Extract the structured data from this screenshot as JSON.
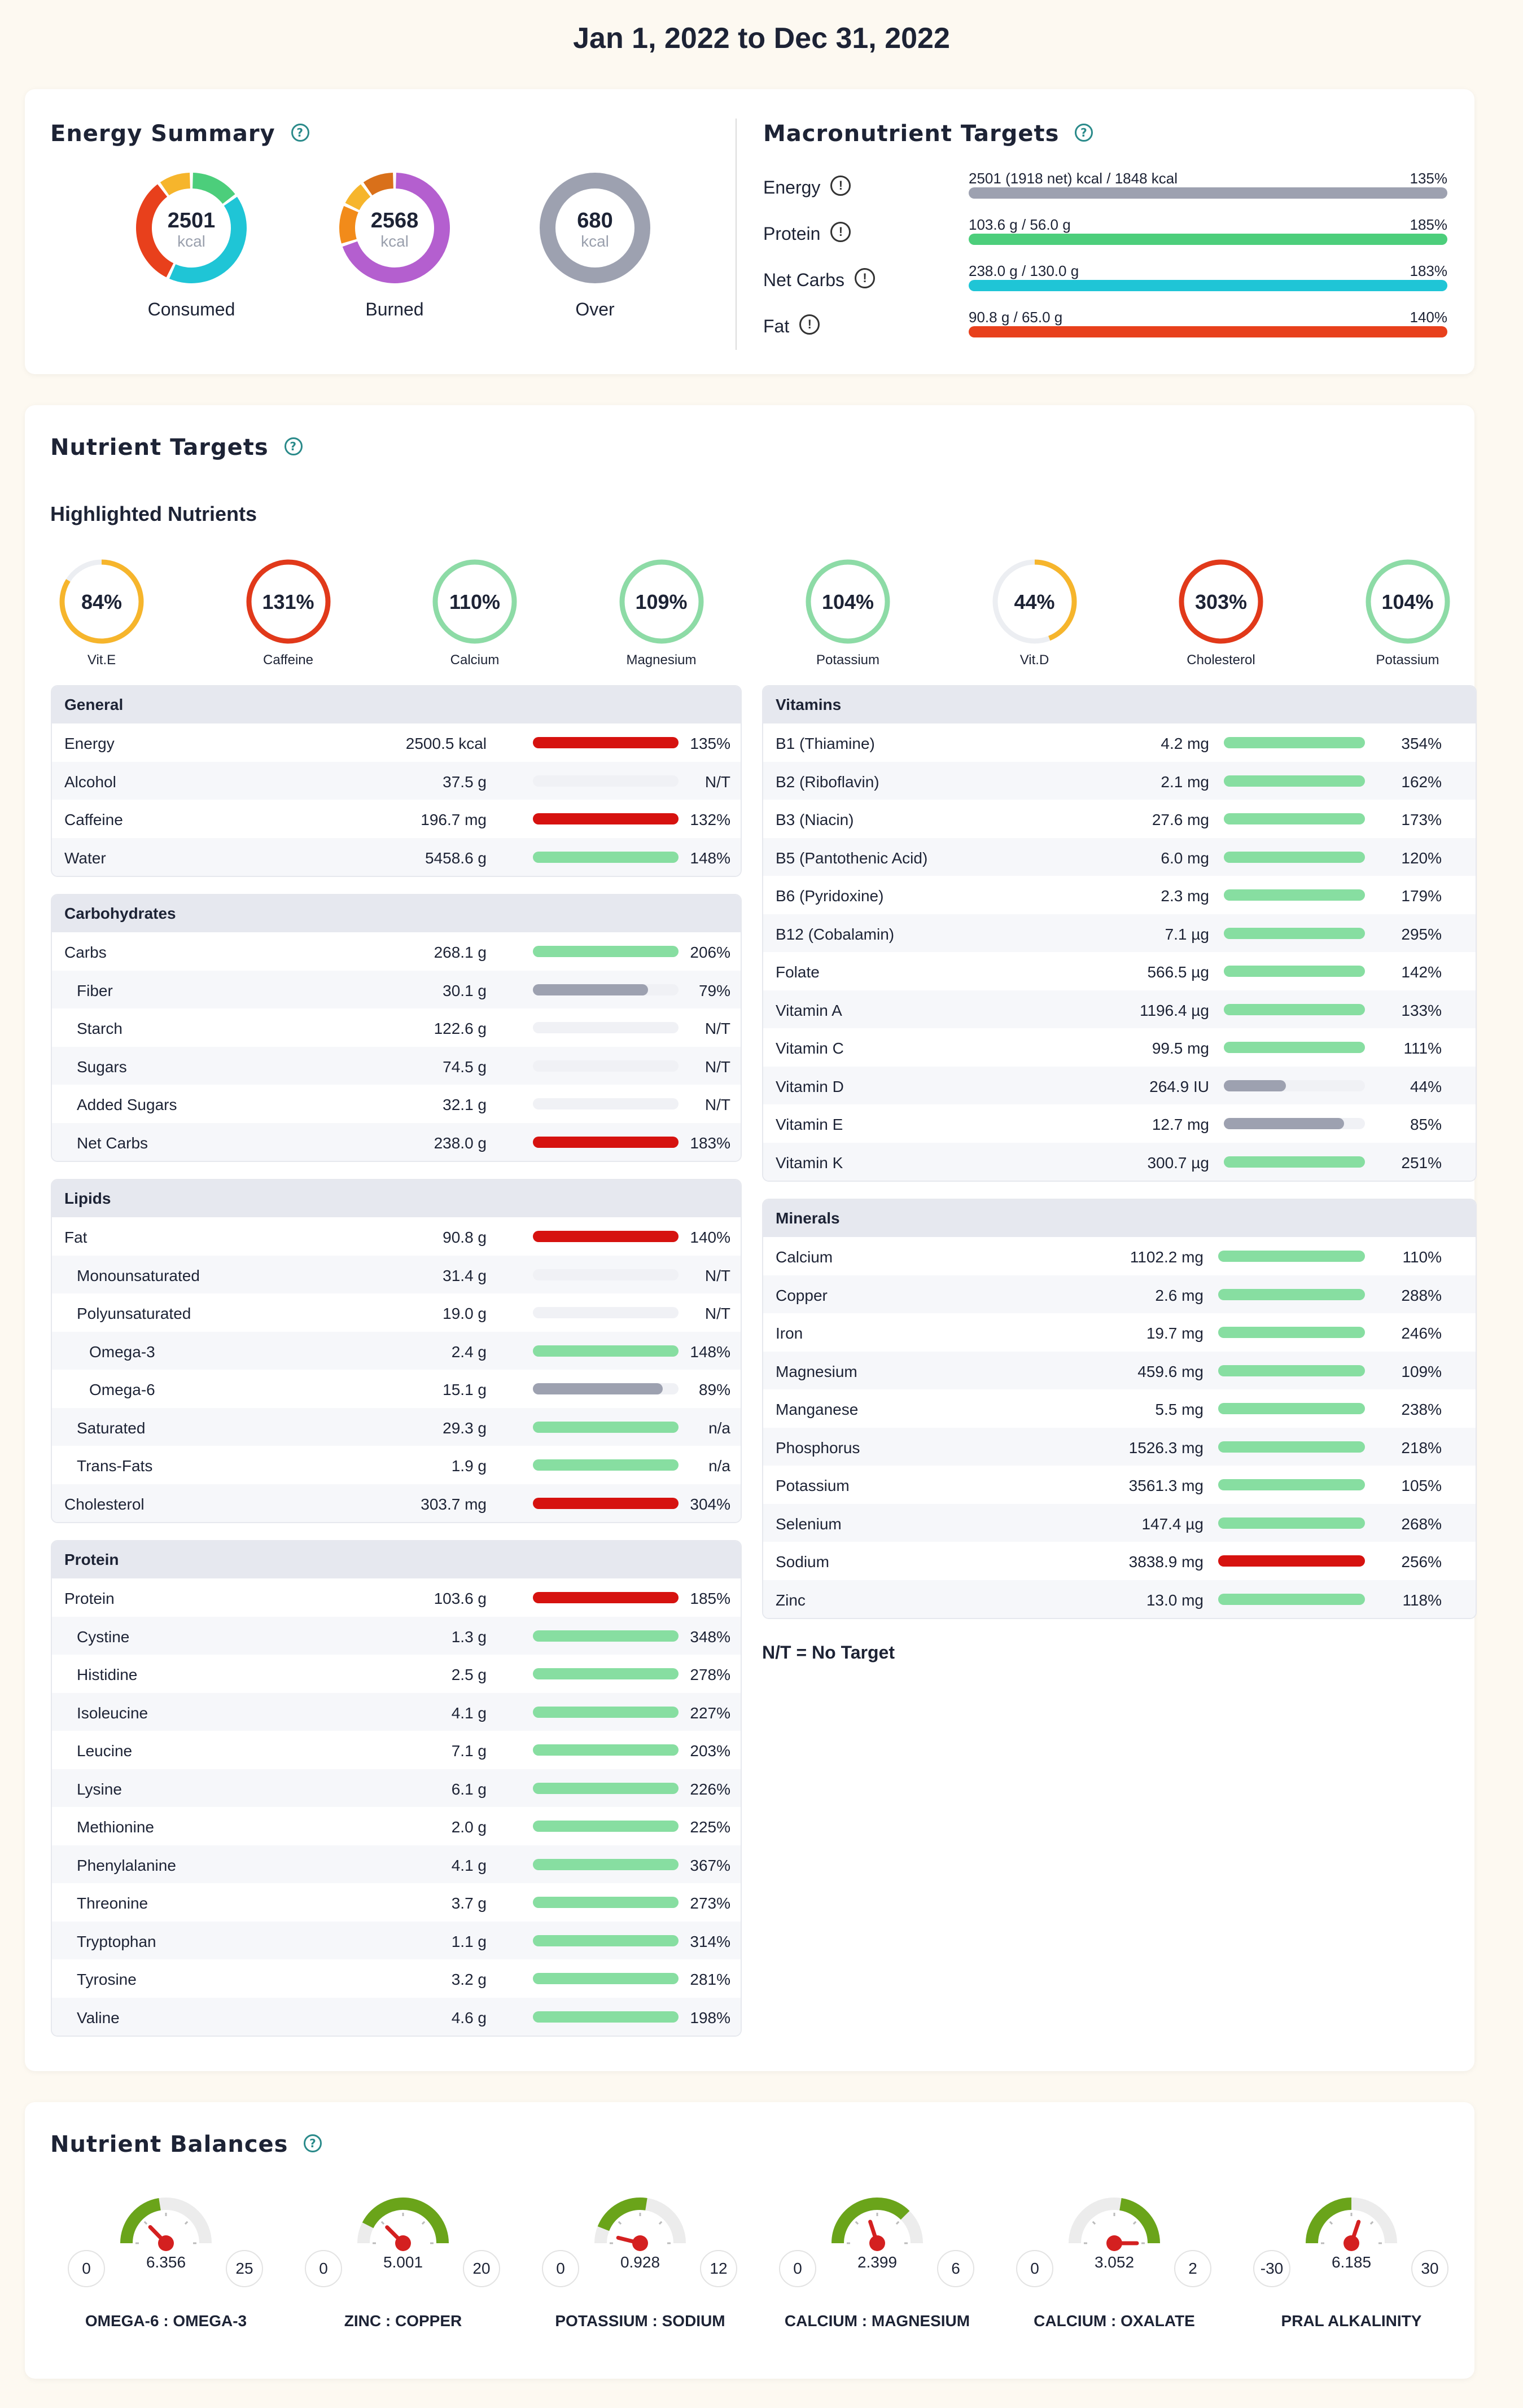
{
  "header": {
    "date_range": "Jan 1, 2022 to Dec 31, 2022"
  },
  "colors": {
    "protein_green": "#4cce7b",
    "carbs_cyan": "#1fc5d6",
    "fat_red": "#e8401c",
    "gray": "#9da1b0",
    "bar_red": "#d6120f",
    "bar_green": "#87dea1",
    "bar_gray": "#9da1b0",
    "gauge_green": "#6aa41a",
    "needle_red": "#d42020",
    "ring_orange": "#f6b52c",
    "ring_red": "#e1391a",
    "ring_green": "#8ddba6"
  },
  "energy_summary": {
    "title": "Energy Summary",
    "help_icon": "question-circle-icon",
    "consumed": {
      "value": "2501",
      "unit": "kcal",
      "label": "Consumed",
      "segments": [
        {
          "color": "#4cce7b",
          "fraction": 0.15
        },
        {
          "color": "#1fc5d6",
          "fraction": 0.42
        },
        {
          "color": "#e8401c",
          "fraction": 0.33
        },
        {
          "color": "#f6b52c",
          "fraction": 0.1
        }
      ]
    },
    "burned": {
      "value": "2568",
      "unit": "kcal",
      "label": "Burned",
      "segments": [
        {
          "color": "#b45fcf",
          "fraction": 0.7
        },
        {
          "color": "#f28b1a",
          "fraction": 0.12
        },
        {
          "color": "#f6b52c",
          "fraction": 0.08
        },
        {
          "color": "#d9701a",
          "fraction": 0.1
        }
      ]
    },
    "over": {
      "value": "680",
      "unit": "kcal",
      "label": "Over",
      "segments": [
        {
          "color": "#9da1b0",
          "fraction": 1.0
        }
      ]
    }
  },
  "macro_targets": {
    "title": "Macronutrient Targets",
    "items": [
      {
        "label": "Energy",
        "text": "2501 (1918 net) kcal / 1848 kcal",
        "pct": "135%",
        "color": "#9da1b0"
      },
      {
        "label": "Protein",
        "text": "103.6 g / 56.0 g",
        "pct": "185%",
        "color": "#4cce7b"
      },
      {
        "label": "Net Carbs",
        "text": "238.0 g / 130.0 g",
        "pct": "183%",
        "color": "#1fc5d6"
      },
      {
        "label": "Fat",
        "text": "90.8 g / 65.0 g",
        "pct": "140%",
        "color": "#e8401c"
      }
    ]
  },
  "nutrient_targets": {
    "title": "Nutrient Targets",
    "highlighted_title": "Highlighted Nutrients",
    "highlighted": [
      {
        "pct": "84%",
        "label": "Vit.E",
        "fraction": 0.84,
        "color": "#f6b52c"
      },
      {
        "pct": "131%",
        "label": "Caffeine",
        "fraction": 1.0,
        "color": "#e1391a"
      },
      {
        "pct": "110%",
        "label": "Calcium",
        "fraction": 1.0,
        "color": "#8ddba6"
      },
      {
        "pct": "109%",
        "label": "Magnesium",
        "fraction": 1.0,
        "color": "#8ddba6"
      },
      {
        "pct": "104%",
        "label": "Potassium",
        "fraction": 1.0,
        "color": "#8ddba6"
      },
      {
        "pct": "44%",
        "label": "Vit.D",
        "fraction": 0.44,
        "color": "#f6b52c"
      },
      {
        "pct": "303%",
        "label": "Cholesterol",
        "fraction": 1.0,
        "color": "#e1391a"
      },
      {
        "pct": "104%",
        "label": "Potassium",
        "fraction": 1.0,
        "color": "#8ddba6"
      }
    ],
    "left_tables": [
      {
        "title": "General",
        "rows": [
          {
            "name": "Energy",
            "amount": "2500.5 kcal",
            "pct": "135%",
            "fill": 1.0,
            "color": "red",
            "indent": 0
          },
          {
            "name": "Alcohol",
            "amount": "37.5 g",
            "pct": "N/T",
            "fill": 0,
            "color": "none",
            "indent": 0
          },
          {
            "name": "Caffeine",
            "amount": "196.7 mg",
            "pct": "132%",
            "fill": 1.0,
            "color": "red",
            "indent": 0
          },
          {
            "name": "Water",
            "amount": "5458.6 g",
            "pct": "148%",
            "fill": 1.0,
            "color": "green",
            "indent": 0
          }
        ]
      },
      {
        "title": "Carbohydrates",
        "rows": [
          {
            "name": "Carbs",
            "amount": "268.1 g",
            "pct": "206%",
            "fill": 1.0,
            "color": "green",
            "indent": 0
          },
          {
            "name": "Fiber",
            "amount": "30.1 g",
            "pct": "79%",
            "fill": 0.79,
            "color": "gray",
            "indent": 1
          },
          {
            "name": "Starch",
            "amount": "122.6 g",
            "pct": "N/T",
            "fill": 0,
            "color": "none",
            "indent": 1
          },
          {
            "name": "Sugars",
            "amount": "74.5 g",
            "pct": "N/T",
            "fill": 0,
            "color": "none",
            "indent": 1
          },
          {
            "name": "Added Sugars",
            "amount": "32.1 g",
            "pct": "N/T",
            "fill": 0,
            "color": "none",
            "indent": 1
          },
          {
            "name": "Net Carbs",
            "amount": "238.0 g",
            "pct": "183%",
            "fill": 1.0,
            "color": "red",
            "indent": 1
          }
        ]
      },
      {
        "title": "Lipids",
        "rows": [
          {
            "name": "Fat",
            "amount": "90.8 g",
            "pct": "140%",
            "fill": 1.0,
            "color": "red",
            "indent": 0
          },
          {
            "name": "Monounsaturated",
            "amount": "31.4 g",
            "pct": "N/T",
            "fill": 0,
            "color": "none",
            "indent": 1
          },
          {
            "name": "Polyunsaturated",
            "amount": "19.0 g",
            "pct": "N/T",
            "fill": 0,
            "color": "none",
            "indent": 1
          },
          {
            "name": "Omega-3",
            "amount": "2.4 g",
            "pct": "148%",
            "fill": 1.0,
            "color": "green",
            "indent": 2
          },
          {
            "name": "Omega-6",
            "amount": "15.1 g",
            "pct": "89%",
            "fill": 0.89,
            "color": "gray",
            "indent": 2
          },
          {
            "name": "Saturated",
            "amount": "29.3 g",
            "pct": "n/a",
            "fill": 1.0,
            "color": "green",
            "indent": 1
          },
          {
            "name": "Trans-Fats",
            "amount": "1.9 g",
            "pct": "n/a",
            "fill": 1.0,
            "color": "green",
            "indent": 1
          },
          {
            "name": "Cholesterol",
            "amount": "303.7 mg",
            "pct": "304%",
            "fill": 1.0,
            "color": "red",
            "indent": 0
          }
        ]
      },
      {
        "title": "Protein",
        "rows": [
          {
            "name": "Protein",
            "amount": "103.6 g",
            "pct": "185%",
            "fill": 1.0,
            "color": "red",
            "indent": 0
          },
          {
            "name": "Cystine",
            "amount": "1.3 g",
            "pct": "348%",
            "fill": 1.0,
            "color": "green",
            "indent": 1
          },
          {
            "name": "Histidine",
            "amount": "2.5 g",
            "pct": "278%",
            "fill": 1.0,
            "color": "green",
            "indent": 1
          },
          {
            "name": "Isoleucine",
            "amount": "4.1 g",
            "pct": "227%",
            "fill": 1.0,
            "color": "green",
            "indent": 1
          },
          {
            "name": "Leucine",
            "amount": "7.1 g",
            "pct": "203%",
            "fill": 1.0,
            "color": "green",
            "indent": 1
          },
          {
            "name": "Lysine",
            "amount": "6.1 g",
            "pct": "226%",
            "fill": 1.0,
            "color": "green",
            "indent": 1
          },
          {
            "name": "Methionine",
            "amount": "2.0 g",
            "pct": "225%",
            "fill": 1.0,
            "color": "green",
            "indent": 1
          },
          {
            "name": "Phenylalanine",
            "amount": "4.1 g",
            "pct": "367%",
            "fill": 1.0,
            "color": "green",
            "indent": 1
          },
          {
            "name": "Threonine",
            "amount": "3.7 g",
            "pct": "273%",
            "fill": 1.0,
            "color": "green",
            "indent": 1
          },
          {
            "name": "Tryptophan",
            "amount": "1.1 g",
            "pct": "314%",
            "fill": 1.0,
            "color": "green",
            "indent": 1
          },
          {
            "name": "Tyrosine",
            "amount": "3.2 g",
            "pct": "281%",
            "fill": 1.0,
            "color": "green",
            "indent": 1
          },
          {
            "name": "Valine",
            "amount": "4.6 g",
            "pct": "198%",
            "fill": 1.0,
            "color": "green",
            "indent": 1
          }
        ]
      }
    ],
    "right_tables": [
      {
        "title": "Vitamins",
        "rows": [
          {
            "name": "B1 (Thiamine)",
            "amount": "4.2 mg",
            "pct": "354%",
            "fill": 1.0,
            "color": "green",
            "indent": 0
          },
          {
            "name": "B2 (Riboflavin)",
            "amount": "2.1 mg",
            "pct": "162%",
            "fill": 1.0,
            "color": "green",
            "indent": 0
          },
          {
            "name": "B3 (Niacin)",
            "amount": "27.6 mg",
            "pct": "173%",
            "fill": 1.0,
            "color": "green",
            "indent": 0
          },
          {
            "name": "B5 (Pantothenic Acid)",
            "amount": "6.0 mg",
            "pct": "120%",
            "fill": 1.0,
            "color": "green",
            "indent": 0
          },
          {
            "name": "B6 (Pyridoxine)",
            "amount": "2.3 mg",
            "pct": "179%",
            "fill": 1.0,
            "color": "green",
            "indent": 0
          },
          {
            "name": "B12 (Cobalamin)",
            "amount": "7.1 µg",
            "pct": "295%",
            "fill": 1.0,
            "color": "green",
            "indent": 0
          },
          {
            "name": "Folate",
            "amount": "566.5 µg",
            "pct": "142%",
            "fill": 1.0,
            "color": "green",
            "indent": 0
          },
          {
            "name": "Vitamin A",
            "amount": "1196.4 µg",
            "pct": "133%",
            "fill": 1.0,
            "color": "green",
            "indent": 0
          },
          {
            "name": "Vitamin C",
            "amount": "99.5 mg",
            "pct": "111%",
            "fill": 1.0,
            "color": "green",
            "indent": 0
          },
          {
            "name": "Vitamin D",
            "amount": "264.9 IU",
            "pct": "44%",
            "fill": 0.44,
            "color": "gray",
            "indent": 0
          },
          {
            "name": "Vitamin E",
            "amount": "12.7 mg",
            "pct": "85%",
            "fill": 0.85,
            "color": "gray",
            "indent": 0
          },
          {
            "name": "Vitamin K",
            "amount": "300.7 µg",
            "pct": "251%",
            "fill": 1.0,
            "color": "green",
            "indent": 0
          }
        ]
      },
      {
        "title": "Minerals",
        "rows": [
          {
            "name": "Calcium",
            "amount": "1102.2 mg",
            "pct": "110%",
            "fill": 1.0,
            "color": "green",
            "indent": 0
          },
          {
            "name": "Copper",
            "amount": "2.6 mg",
            "pct": "288%",
            "fill": 1.0,
            "color": "green",
            "indent": 0
          },
          {
            "name": "Iron",
            "amount": "19.7 mg",
            "pct": "246%",
            "fill": 1.0,
            "color": "green",
            "indent": 0
          },
          {
            "name": "Magnesium",
            "amount": "459.6 mg",
            "pct": "109%",
            "fill": 1.0,
            "color": "green",
            "indent": 0
          },
          {
            "name": "Manganese",
            "amount": "5.5 mg",
            "pct": "238%",
            "fill": 1.0,
            "color": "green",
            "indent": 0
          },
          {
            "name": "Phosphorus",
            "amount": "1526.3 mg",
            "pct": "218%",
            "fill": 1.0,
            "color": "green",
            "indent": 0
          },
          {
            "name": "Potassium",
            "amount": "3561.3 mg",
            "pct": "105%",
            "fill": 1.0,
            "color": "green",
            "indent": 0
          },
          {
            "name": "Selenium",
            "amount": "147.4 µg",
            "pct": "268%",
            "fill": 1.0,
            "color": "green",
            "indent": 0
          },
          {
            "name": "Sodium",
            "amount": "3838.9 mg",
            "pct": "256%",
            "fill": 1.0,
            "color": "red",
            "indent": 0
          },
          {
            "name": "Zinc",
            "amount": "13.0 mg",
            "pct": "118%",
            "fill": 1.0,
            "color": "green",
            "indent": 0
          }
        ]
      }
    ],
    "note": "N/T = No Target"
  },
  "balances": {
    "title": "Nutrient Balances",
    "gauges": [
      {
        "label": "OMEGA-6 : OMEGA-3",
        "min": "0",
        "max": "25",
        "value": "6.356",
        "num": 6.356,
        "lo": 0,
        "hi": 25,
        "green_start": 0,
        "green_end": 0.45
      },
      {
        "label": "ZINC : COPPER",
        "min": "0",
        "max": "20",
        "value": "5.001",
        "num": 5.001,
        "lo": 0,
        "hi": 20,
        "green_start": 0.15,
        "green_end": 1.0
      },
      {
        "label": "POTASSIUM : SODIUM",
        "min": "0",
        "max": "12",
        "value": "0.928",
        "num": 0.928,
        "lo": 0,
        "hi": 12,
        "green_start": 0.12,
        "green_end": 0.55
      },
      {
        "label": "CALCIUM : MAGNESIUM",
        "min": "0",
        "max": "6",
        "value": "2.399",
        "num": 2.399,
        "lo": 0,
        "hi": 6,
        "green_start": 0.0,
        "green_end": 0.75
      },
      {
        "label": "CALCIUM : OXALATE",
        "min": "0",
        "max": "2",
        "value": "3.052",
        "num": 3.052,
        "lo": 0,
        "hi": 2,
        "green_start": 0.55,
        "green_end": 1.0
      },
      {
        "label": "PRAL ALKALINITY",
        "min": "-30",
        "max": "30",
        "value": "6.185",
        "num": 6.185,
        "lo": -30,
        "hi": 30,
        "green_start": 0.0,
        "green_end": 0.5
      }
    ]
  }
}
